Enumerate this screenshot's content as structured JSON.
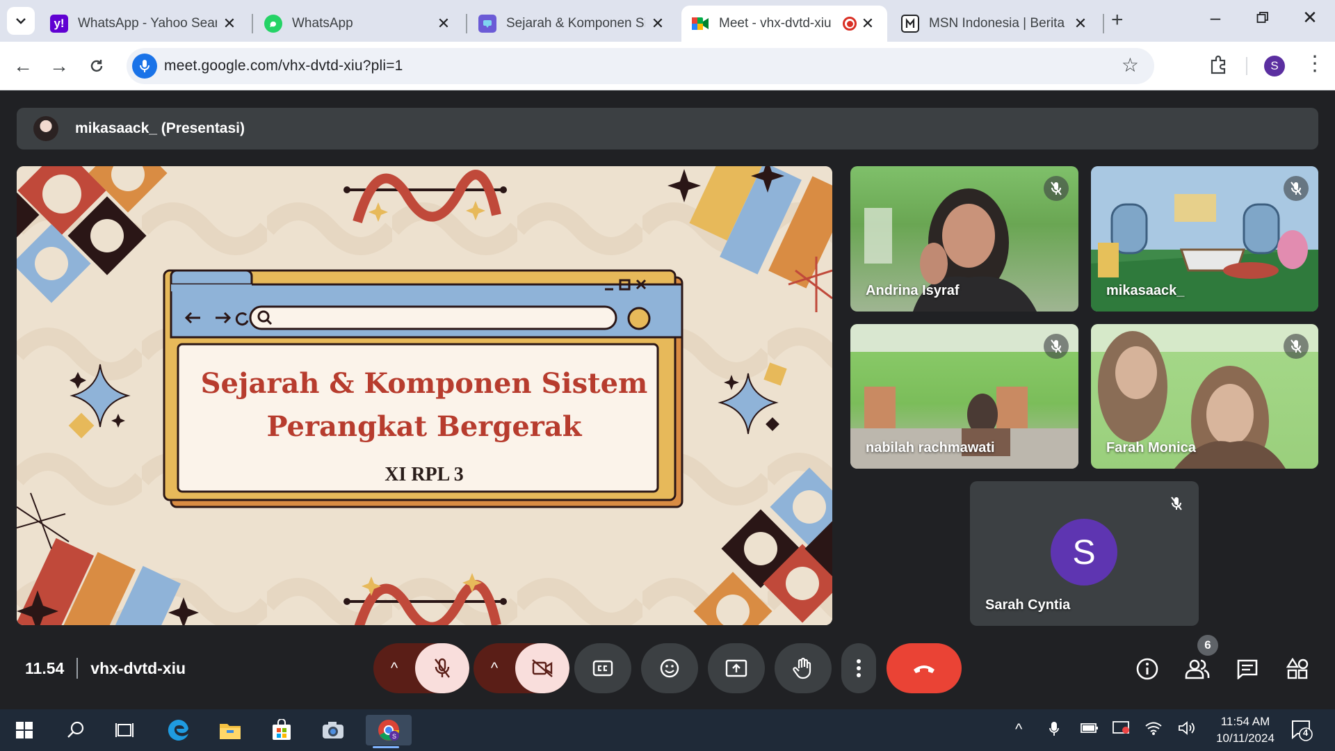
{
  "browser": {
    "tabs": [
      {
        "title": "WhatsApp - Yahoo Search",
        "favicon": "yahoo-icon"
      },
      {
        "title": "WhatsApp",
        "favicon": "whatsapp-icon"
      },
      {
        "title": "Sejarah & Komponen Sistem",
        "favicon": "canva-icon"
      },
      {
        "title": "Meet - vhx-dvtd-xiu",
        "favicon": "meet-icon",
        "active": true,
        "recording": true
      },
      {
        "title": "MSN Indonesia | Berita Terkini",
        "favicon": "msn-icon"
      }
    ],
    "url": "meet.google.com/vhx-dvtd-xiu?pli=1",
    "profile_initial": "S"
  },
  "meet": {
    "presenter_label": "mikasaack_ (Presentasi)",
    "slide": {
      "title_line1": "Sejarah & Komponen Sistem",
      "title_line2": "Perangkat Bergerak",
      "subtitle": "XI RPL 3"
    },
    "participants": [
      {
        "name": "Andrina Isyraf",
        "muted": true
      },
      {
        "name": "mikasaack_",
        "muted": true
      },
      {
        "name": "nabilah rachmawati",
        "muted": true
      },
      {
        "name": "Farah Monica",
        "muted": true
      },
      {
        "name": "Sarah Cyntia",
        "muted": true,
        "initial": "S"
      }
    ],
    "time": "11.54",
    "meeting_code": "vhx-dvtd-xiu",
    "participant_count": "6"
  },
  "taskbar": {
    "time": "11:54 AM",
    "date": "10/11/2024",
    "notification_count": "4"
  },
  "colors": {
    "meet_bg": "#202124",
    "end_call": "#ea4335",
    "slide_title": "#b73c2e",
    "muted_control": "#f9dedc"
  }
}
